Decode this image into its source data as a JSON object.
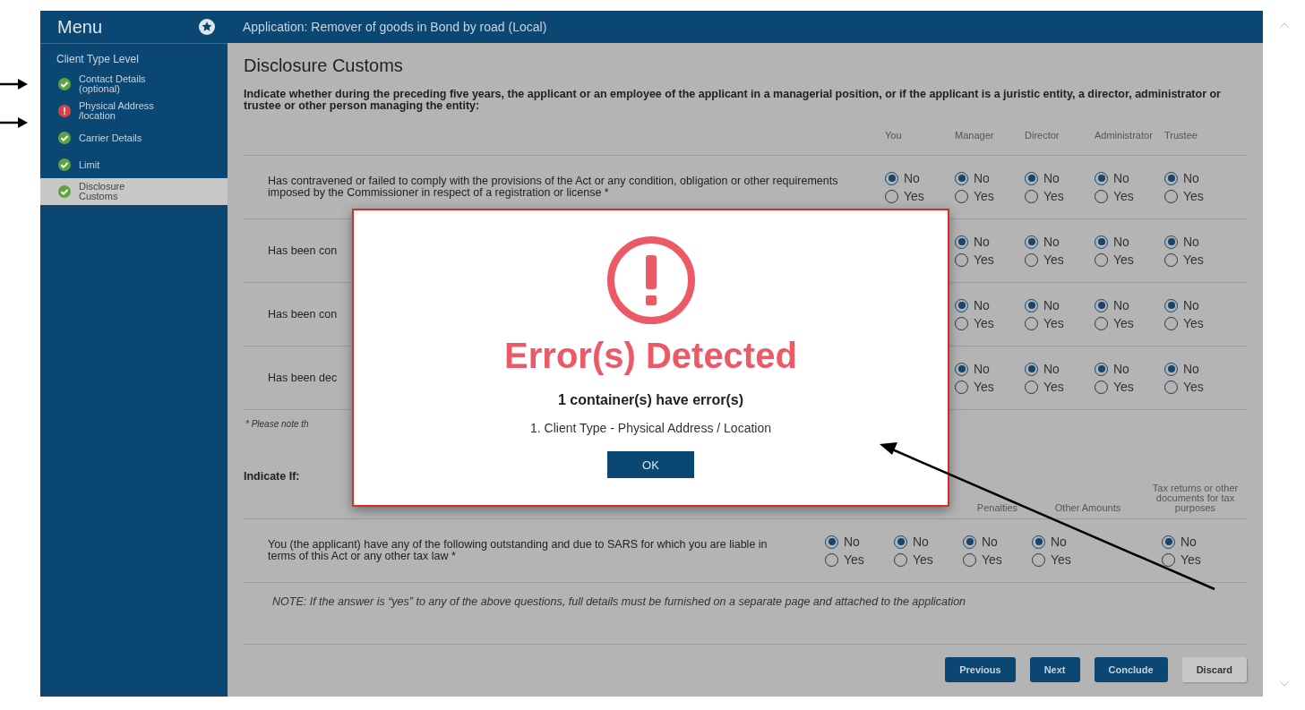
{
  "sidebar": {
    "title": "Menu",
    "section": "Client Type Level",
    "items": [
      {
        "label": "Contact Details (optional)",
        "kind": "ok",
        "selected": false
      },
      {
        "label": "Physical Address /location",
        "kind": "error",
        "selected": false
      },
      {
        "label": "Carrier Details",
        "kind": "ok",
        "selected": false
      },
      {
        "label": "Limit",
        "kind": "ok",
        "selected": false
      },
      {
        "label": "Disclosure Customs",
        "kind": "ok",
        "selected": true
      }
    ]
  },
  "header": {
    "title": "Application: Remover of goods in Bond by road (Local)"
  },
  "page": {
    "title": "Disclosure Customs",
    "intro": "Indicate whether during the preceding five years, the applicant or an employee of the applicant in a managerial position, or if the applicant is a juristic entity, a director, administrator or trustee or other person managing the entity:",
    "columns": [
      "You",
      "Manager",
      "Director",
      "Administrator",
      "Trustee"
    ],
    "questions": [
      {
        "text": "Has contravened or failed to comply with the provisions of the Act or any condition, obligation or other requirements imposed by the Commissioner in respect of a registration or license *",
        "answers": [
          [
            {
              "label": "No",
              "selected": true
            },
            {
              "label": "Yes",
              "selected": false
            }
          ],
          [
            {
              "label": "No",
              "selected": true
            },
            {
              "label": "Yes",
              "selected": false
            }
          ],
          [
            {
              "label": "No",
              "selected": true
            },
            {
              "label": "Yes",
              "selected": false
            }
          ],
          [
            {
              "label": "No",
              "selected": true
            },
            {
              "label": "Yes",
              "selected": false
            }
          ],
          [
            {
              "label": "No",
              "selected": true
            },
            {
              "label": "Yes",
              "selected": false
            }
          ]
        ]
      },
      {
        "text": "Has been con",
        "answers": [
          [
            {
              "label": "No",
              "selected": true
            },
            {
              "label": "Yes",
              "selected": false
            }
          ],
          [
            {
              "label": "No",
              "selected": true
            },
            {
              "label": "Yes",
              "selected": false
            }
          ],
          [
            {
              "label": "No",
              "selected": true
            },
            {
              "label": "Yes",
              "selected": false
            }
          ],
          [
            {
              "label": "No",
              "selected": true
            },
            {
              "label": "Yes",
              "selected": false
            }
          ]
        ]
      },
      {
        "text": "Has been con",
        "answers": [
          [
            {
              "label": "No",
              "selected": true
            },
            {
              "label": "Yes",
              "selected": false
            }
          ],
          [
            {
              "label": "No",
              "selected": true
            },
            {
              "label": "Yes",
              "selected": false
            }
          ],
          [
            {
              "label": "No",
              "selected": true
            },
            {
              "label": "Yes",
              "selected": false
            }
          ],
          [
            {
              "label": "No",
              "selected": true
            },
            {
              "label": "Yes",
              "selected": false
            }
          ]
        ]
      },
      {
        "text": "Has been dec",
        "answers": [
          [
            {
              "label": "No",
              "selected": true
            },
            {
              "label": "Yes",
              "selected": false
            }
          ],
          [
            {
              "label": "No",
              "selected": true
            },
            {
              "label": "Yes",
              "selected": false
            }
          ],
          [
            {
              "label": "No",
              "selected": true
            },
            {
              "label": "Yes",
              "selected": false
            }
          ],
          [
            {
              "label": "No",
              "selected": true
            },
            {
              "label": "Yes",
              "selected": false
            }
          ]
        ]
      }
    ],
    "footnote": "* Please note th",
    "indicate_label": "Indicate If:",
    "tax_columns": [
      "Penalties",
      "Other Amounts",
      "Tax returns or other documents for tax purposes"
    ],
    "tax_question": {
      "text": "You (the applicant) have any of the following outstanding and due to SARS for which you are liable in terms of this Act or any other tax law *",
      "answers": [
        [
          {
            "label": "No",
            "selected": true
          },
          {
            "label": "Yes",
            "selected": false
          }
        ],
        [
          {
            "label": "No",
            "selected": true
          },
          {
            "label": "Yes",
            "selected": false
          }
        ],
        [
          {
            "label": "No",
            "selected": true
          },
          {
            "label": "Yes",
            "selected": false
          }
        ],
        [
          {
            "label": "No",
            "selected": true
          },
          {
            "label": "Yes",
            "selected": false
          }
        ],
        [
          {
            "label": "No",
            "selected": true
          },
          {
            "label": "Yes",
            "selected": false
          }
        ]
      ]
    },
    "note": "NOTE:  If the answer is “yes” to any of the above questions, full details must be furnished on a separate page and attached to the application",
    "buttons": [
      {
        "label": "Previous",
        "kind": "primary"
      },
      {
        "label": "Next",
        "kind": "primary"
      },
      {
        "label": "Conclude",
        "kind": "primary"
      },
      {
        "label": "Discard",
        "kind": "secondary"
      }
    ]
  },
  "dialog": {
    "title": "Error(s) Detected",
    "subtitle": "1 container(s) have error(s)",
    "errors": [
      "1. Client Type - Physical Address / Location"
    ],
    "button": "OK"
  }
}
